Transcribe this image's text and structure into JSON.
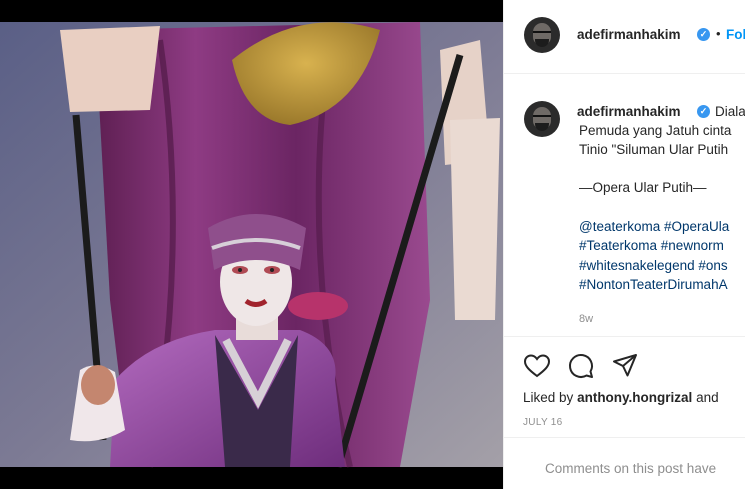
{
  "post": {
    "image_alt": "Theater performer in white face makeup and a purple robe holding a pole with a pennant on stage",
    "header": {
      "username": "adefirmanhakim",
      "verified_icon": "verified-badge-icon",
      "separator": "•",
      "follow_label": "Follow"
    },
    "caption": {
      "username": "adefirmanhakim",
      "line1_start": "Diala",
      "line2": "Pemuda yang Jatuh cinta",
      "line3": "Tinio \"Siluman Ular Putih",
      "line4": "—Opera Ular Putih—",
      "tags1": "@teaterkoma #OperaUla",
      "tags2": "#Teaterkoma #newnorm",
      "tags3": "#whitesnakelegend #ons",
      "tags4": "#NontonTeaterDirumahA",
      "time_ago": "8w"
    },
    "actions": {
      "like_icon": "heart-icon",
      "comment_icon": "comment-icon",
      "share_icon": "share-icon",
      "liked_prefix": "Liked by",
      "liked_user": "anthony.hongrizal",
      "liked_suffix": "and",
      "date": "JULY 16"
    },
    "comments_notice": "Comments on this post have"
  },
  "colors": {
    "accent": "#0095f6",
    "verified": "#3897f0",
    "hashtag": "#00376b",
    "muted": "#8e8e8e",
    "costume_purple": "#7a2f8c"
  }
}
